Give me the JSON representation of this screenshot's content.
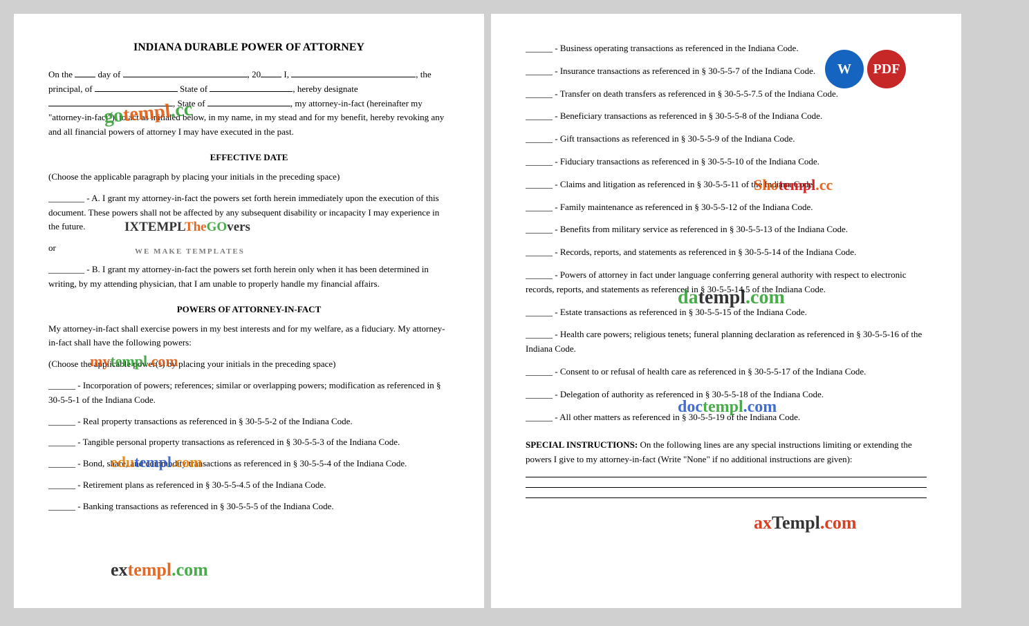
{
  "document": {
    "title": "INDIANA DURABLE POWER OF ATTORNEY",
    "left_page": {
      "intro": "On the ___ day of _________________, 20___ I, __________________, the principal, of _________________ State of ___________, hereby designate _________________, State of ________________, my attorney-in-fact (hereinafter my \"attorney-in-fact\"), to act as initialed below, in my name, in my stead and for my benefit, hereby revoking any and all financial powers of attorney I may have executed in the past.",
      "effective_date_title": "EFFECTIVE DATE",
      "effective_date_text": "(Choose the applicable paragraph by placing your initials in the preceding space)",
      "option_a": "________ - A. I grant my attorney-in-fact the powers set forth herein immediately upon the execution of this document. These powers shall not be affected by any subsequent disability or incapacity I may experience in the future.",
      "or_text": "or",
      "option_b": "________ - B. I grant my attorney-in-fact the powers set forth herein only when it has been determined in writing, by my attending physician, that I am unable to properly handle my financial affairs.",
      "powers_title": "POWERS OF ATTORNEY-IN-FACT",
      "powers_intro": "My attorney-in-fact shall exercise powers in my best interests and for my welfare, as a fiduciary. My attorney-in-fact shall have the following powers:",
      "powers_choose": "(Choose the applicable power(s) by placing your initials in the preceding space)",
      "powers_items": [
        "______ - Incorporation of powers; references; similar or overlapping powers; modification as referenced in § 30-5-5-1 of the Indiana Code.",
        "______ - Real property transactions as referenced in § 30-5-5-2 of the Indiana Code.",
        "______ - Tangible personal property transactions as referenced in § 30-5-5-3 of the Indiana Code.",
        "______ - Bond, share, and commodity transactions as referenced in § 30-5-5-4 of the Indiana Code.",
        "______ - Retirement plans as referenced in § 30-5-5-4.5 of the Indiana Code.",
        "______ - Banking transactions as referenced in § 30-5-5-5 of the Indiana Code."
      ]
    },
    "right_page": {
      "items": [
        "______ - Business operating transactions as referenced in the Indiana Code.",
        "______ - Insurance transactions as referenced in § 30-5-5-7 of the Indiana Code.",
        "______ - Transfer on death transfers as referenced in § 30-5-5-7.5 of the Indiana Code.",
        "______ - Beneficiary transactions as referenced in § 30-5-5-8 of the Indiana Code.",
        "______ - Gift transactions as referenced in § 30-5-5-9 of the Indiana Code.",
        "______ - Fiduciary transactions as referenced in § 30-5-5-10 of the Indiana Code.",
        "______ - Claims and litigation as referenced in § 30-5-5-11 of the Indiana Code.",
        "______ - Family maintenance as referenced in § 30-5-5-12 of the Indiana Code.",
        "______ - Benefits from military service as referenced in § 30-5-5-13 of the Indiana Code.",
        "______ - Records, reports, and statements as referenced in § 30-5-5-14 of the Indiana Code.",
        "______ - Powers of attorney in fact under language conferring general authority with respect to electronic records, reports, and statements as referenced in § 30-5-5-14.5 of the Indiana Code.",
        "______ - Estate transactions as referenced in § 30-5-5-15 of the Indiana Code.",
        "______ - Health care powers; religious tenets; funeral planning declaration as referenced in § 30-5-5-16 of the Indiana Code.",
        "______ - Consent to or refusal of health care as referenced in § 30-5-5-17 of the Indiana Code.",
        "______ - Delegation of authority as referenced in § 30-5-5-18 of the Indiana Code.",
        "______ - All other matters as referenced in § 30-5-5-19 of the Indiana Code."
      ],
      "special_instructions_label": "SPECIAL INSTRUCTIONS:",
      "special_instructions_text": "On the following lines are any special instructions limiting or extending the powers I give to my attorney-in-fact (Write \"None\" if no additional instructions are given):"
    },
    "badges": {
      "w_label": "W",
      "pdf_label": "PDF"
    }
  }
}
